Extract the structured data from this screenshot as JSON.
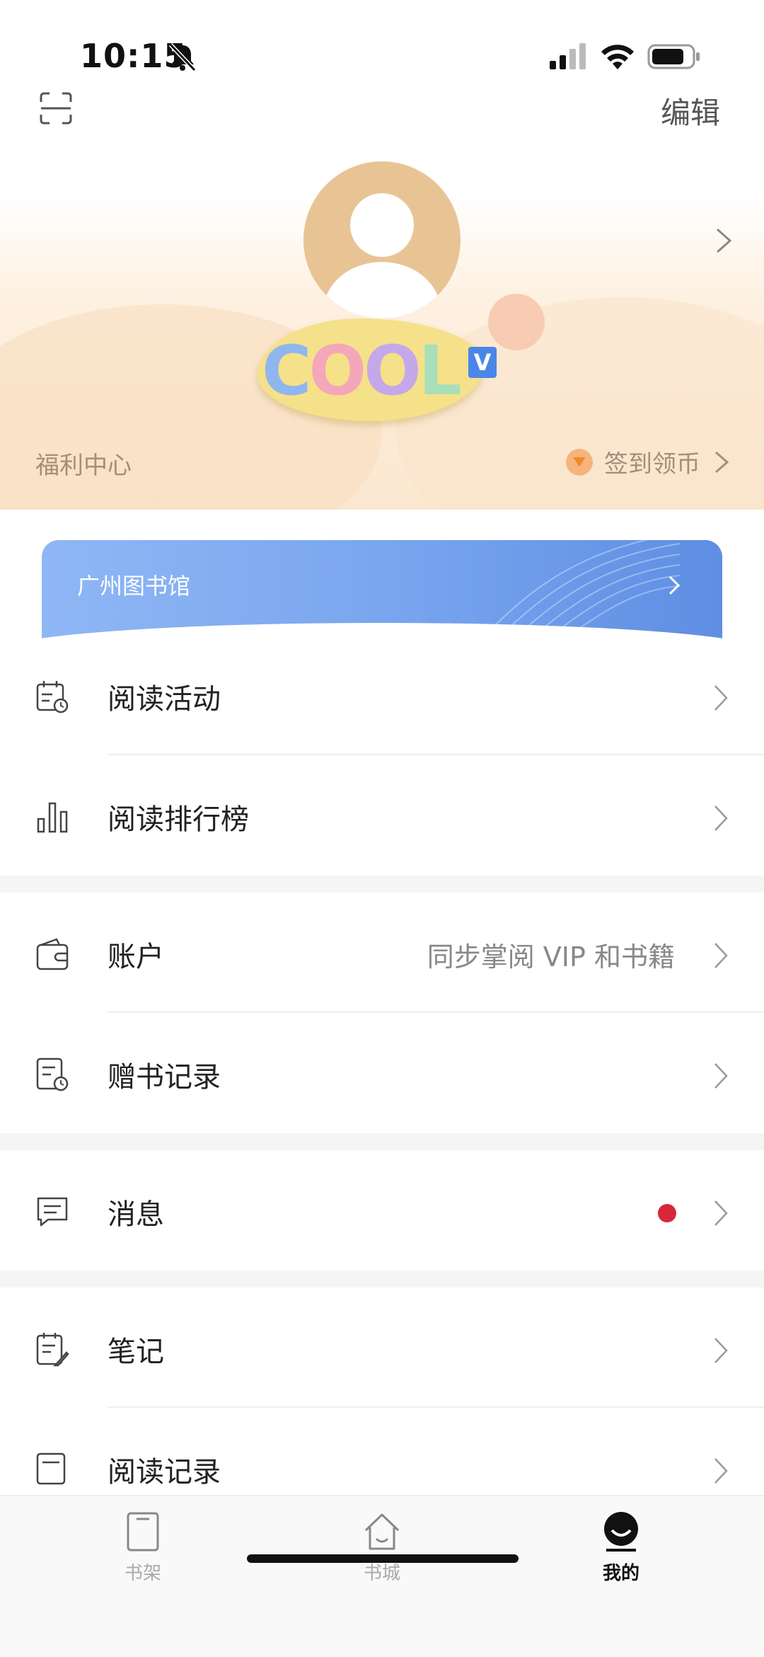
{
  "status_bar": {
    "time": "10:15"
  },
  "header": {
    "edit_label": "编辑",
    "badge_text": [
      "C",
      "O",
      "O",
      "L"
    ],
    "badge_vip_letter": "V",
    "welfare_label": "福利中心",
    "signin_label": "签到领币"
  },
  "library": {
    "label": "广州图书馆"
  },
  "menu": {
    "reading_activities": {
      "label": "阅读活动"
    },
    "reading_ranking": {
      "label": "阅读排行榜"
    },
    "account": {
      "label": "账户",
      "value": "同步掌阅 VIP 和书籍"
    },
    "gift_records": {
      "label": "赠书记录"
    },
    "messages": {
      "label": "消息"
    },
    "notes": {
      "label": "笔记"
    },
    "reading_history": {
      "label": "阅读记录"
    }
  },
  "tabbar": {
    "items": [
      {
        "label": "书架",
        "icon": "bookshelf-icon",
        "active": false
      },
      {
        "label": "书城",
        "icon": "home-icon",
        "active": false
      },
      {
        "label": "我的",
        "icon": "profile-icon",
        "active": true
      }
    ]
  },
  "colors": {
    "accent_blue": "#5f8ee3",
    "notification_red": "#d7283a",
    "avatar_bg": "#e8c495",
    "welfare_text": "#a38f79"
  }
}
